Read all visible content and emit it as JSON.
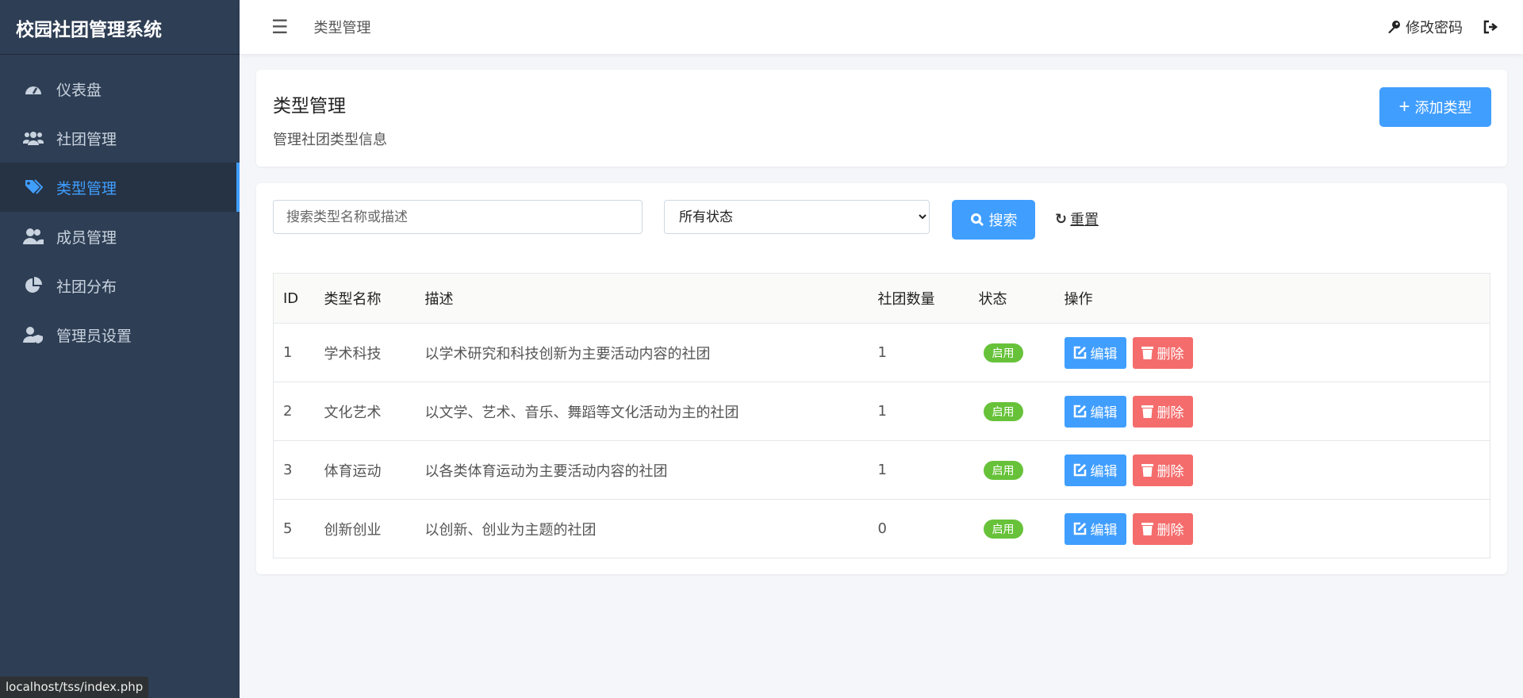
{
  "app_title": "校园社团管理系统",
  "sidebar": {
    "items": [
      {
        "label": "仪表盘",
        "icon": "dashboard-icon"
      },
      {
        "label": "社团管理",
        "icon": "users-icon"
      },
      {
        "label": "类型管理",
        "icon": "tags-icon",
        "active": true
      },
      {
        "label": "成员管理",
        "icon": "user-friends-icon"
      },
      {
        "label": "社团分布",
        "icon": "pie-chart-icon"
      },
      {
        "label": "管理员设置",
        "icon": "user-shield-icon"
      }
    ]
  },
  "header": {
    "breadcrumb": "类型管理",
    "change_password": "修改密码"
  },
  "page": {
    "title": "类型管理",
    "subtitle": "管理社团类型信息",
    "add_button": "添加类型"
  },
  "filters": {
    "search_placeholder": "搜索类型名称或描述",
    "status_selected": "所有状态",
    "search_button": "搜索",
    "reset_button": "重置"
  },
  "table": {
    "headers": [
      "ID",
      "类型名称",
      "描述",
      "社团数量",
      "状态",
      "操作"
    ],
    "rows": [
      {
        "id": "1",
        "name": "学术科技",
        "desc": "以学术研究和科技创新为主要活动内容的社团",
        "count": "1",
        "status": "启用"
      },
      {
        "id": "2",
        "name": "文化艺术",
        "desc": "以文学、艺术、音乐、舞蹈等文化活动为主的社团",
        "count": "1",
        "status": "启用"
      },
      {
        "id": "3",
        "name": "体育运动",
        "desc": "以各类体育运动为主要活动内容的社团",
        "count": "1",
        "status": "启用"
      },
      {
        "id": "5",
        "name": "创新创业",
        "desc": "以创新、创业为主题的社团",
        "count": "0",
        "status": "启用"
      }
    ],
    "edit_label": "编辑",
    "delete_label": "删除"
  },
  "statusbar": "localhost/tss/index.php",
  "colors": {
    "primary": "#409eff",
    "danger": "#f56c6c",
    "success": "#67c23a",
    "sidebar": "#2e3e54"
  }
}
